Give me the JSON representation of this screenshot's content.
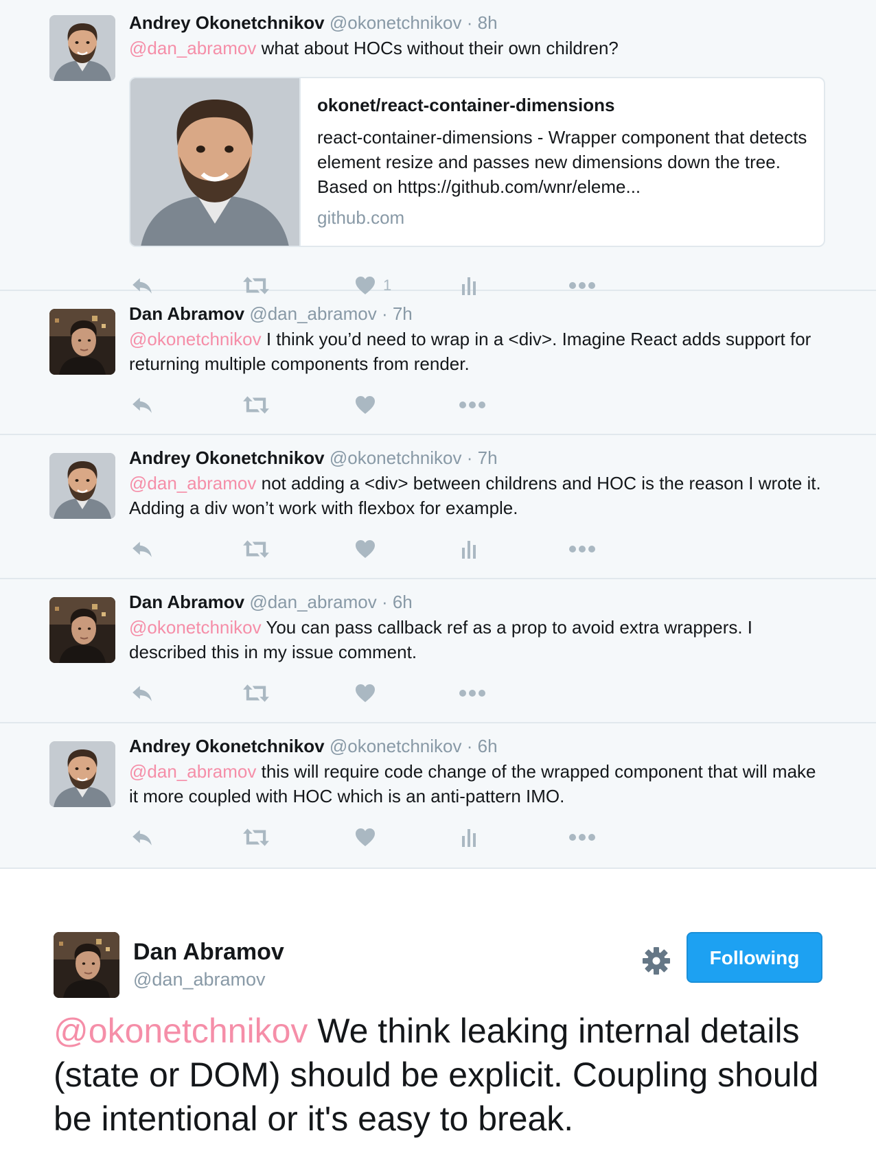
{
  "replies": [
    {
      "name": "Andrey Okonetchnikov",
      "handle": "@okonetchnikov",
      "dot": "·",
      "time": "8h",
      "mention": "@dan_abramov",
      "text": " what about HOCs without their own children?",
      "card": {
        "title": "okonet/react-container-dimensions",
        "description": "react-container-dimensions - Wrapper component that detects element resize and passes new dimensions down the tree. Based on https://github.com/wnr/eleme...",
        "domain": "github.com"
      },
      "like_count": "1"
    },
    {
      "name": "Dan Abramov",
      "handle": "@dan_abramov",
      "dot": "·",
      "time": "7h",
      "mention": "@okonetchnikov",
      "text": " I think you’d need to wrap in a <div>. Imagine React adds support for returning multiple components from render."
    },
    {
      "name": "Andrey Okonetchnikov",
      "handle": "@okonetchnikov",
      "dot": "·",
      "time": "7h",
      "mention": "@dan_abramov",
      "text": " not adding a <div> between childrens and HOC is the reason I wrote it. Adding a div won’t  work with flexbox for example."
    },
    {
      "name": "Dan Abramov",
      "handle": "@dan_abramov",
      "dot": "·",
      "time": "6h",
      "mention": "@okonetchnikov",
      "text": " You can pass callback ref as a prop to avoid extra wrappers. I described this in my issue comment."
    },
    {
      "name": "Andrey Okonetchnikov",
      "handle": "@okonetchnikov",
      "dot": "·",
      "time": "6h",
      "mention": "@dan_abramov",
      "text": " this will require code change of the wrapped component that will make it more coupled with HOC which is an anti-pattern IMO."
    }
  ],
  "main_tweet": {
    "name": "Dan Abramov",
    "handle": "@dan_abramov",
    "follow_label": "Following",
    "mention": "@okonetchnikov",
    "text": " We think leaking internal details (state or DOM) should be explicit. Coupling should be intentional or it's easy to break."
  },
  "icons": [
    "reply-icon",
    "retweet-icon",
    "like-icon",
    "analytics-icon",
    "more-icon",
    "gear-icon"
  ],
  "colors": {
    "background": "#f5f8fa",
    "mention": "#f58ea8",
    "secondary_text": "#8899a6",
    "action_icon": "#aab8c2",
    "follow_button": "#1da1f2"
  }
}
